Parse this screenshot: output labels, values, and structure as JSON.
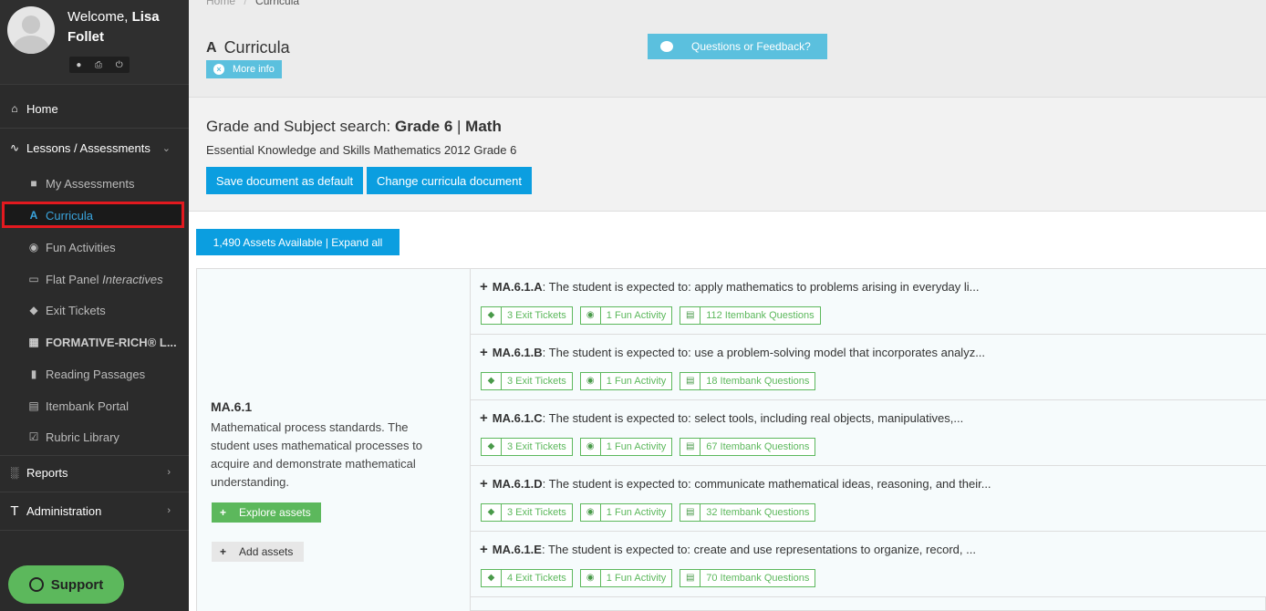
{
  "sidebar": {
    "welcome_prefix": "Welcome,",
    "user_name": "Lisa Follet",
    "nav": [
      {
        "label": "Home",
        "icon": "home-icon"
      },
      {
        "label": "Lessons / Assessments",
        "icon": "pulse-icon"
      },
      {
        "label": "My Assessments",
        "icon": "folder-icon"
      },
      {
        "label": "Curricula",
        "icon": "road-icon"
      },
      {
        "label": "Fun Activities",
        "icon": "gamepad-icon"
      },
      {
        "label": "Flat Panel",
        "label_em": "Interactives",
        "icon": "monitor-icon"
      },
      {
        "label": "Exit Tickets",
        "icon": "ticket-icon"
      },
      {
        "label": "FORMATIVE-RICH® L...",
        "icon": "map-icon"
      },
      {
        "label": "Reading Passages",
        "icon": "book-icon"
      },
      {
        "label": "Itembank Portal",
        "icon": "bank-icon"
      },
      {
        "label": "Rubric Library",
        "icon": "checkbox-icon"
      },
      {
        "label": "Reports",
        "icon": "bar-chart-icon"
      },
      {
        "label": "Administration",
        "icon": "t-icon"
      }
    ],
    "support_label": "Support"
  },
  "breadcrumb": {
    "home": "Home",
    "sep": "/",
    "current": "Curricula"
  },
  "header": {
    "title": "Curricula",
    "more_info": "More info",
    "feedback": "Questions or Feedback?"
  },
  "search": {
    "prefix": "Grade and Subject search:",
    "grade": "Grade 6",
    "divider": "|",
    "subject": "Math",
    "document": "Essential Knowledge and Skills Mathematics 2012 Grade 6",
    "save_default": "Save document as default",
    "change_doc": "Change curricula document"
  },
  "assets_button": "1,490 Assets Available | Expand all",
  "standard": {
    "code": "MA.6.1",
    "description": "Mathematical process standards. The student uses mathematical processes to acquire and demonstrate mathematical understanding.",
    "explore": "Explore assets",
    "add": "Add assets"
  },
  "rows": [
    {
      "code": "MA.6.1.A",
      "text": ": The student is expected to: apply mathematics to problems arising in everyday li...",
      "exit": "3 Exit Tickets",
      "fun": "1 Fun Activity",
      "bank": "112 Itembank Questions"
    },
    {
      "code": "MA.6.1.B",
      "text": ": The student is expected to: use a problem-solving model that incorporates analyz...",
      "exit": "3 Exit Tickets",
      "fun": "1 Fun Activity",
      "bank": "18 Itembank Questions"
    },
    {
      "code": "MA.6.1.C",
      "text": ": The student is expected to: select tools, including real objects, manipulatives,...",
      "exit": "3 Exit Tickets",
      "fun": "1 Fun Activity",
      "bank": "67 Itembank Questions"
    },
    {
      "code": "MA.6.1.D",
      "text": ": The student is expected to: communicate mathematical ideas, reasoning, and their...",
      "exit": "3 Exit Tickets",
      "fun": "1 Fun Activity",
      "bank": "32 Itembank Questions"
    },
    {
      "code": "MA.6.1.E",
      "text": ": The student is expected to: create and use representations to organize, record, ...",
      "exit": "4 Exit Tickets",
      "fun": "1 Fun Activity",
      "bank": "70 Itembank Questions"
    }
  ],
  "colors": {
    "sidebar": "#2b2b2b",
    "primary": "#0b9ee0",
    "info": "#5bc0de",
    "success": "#5cb85c",
    "highlight": "#e3191f"
  }
}
